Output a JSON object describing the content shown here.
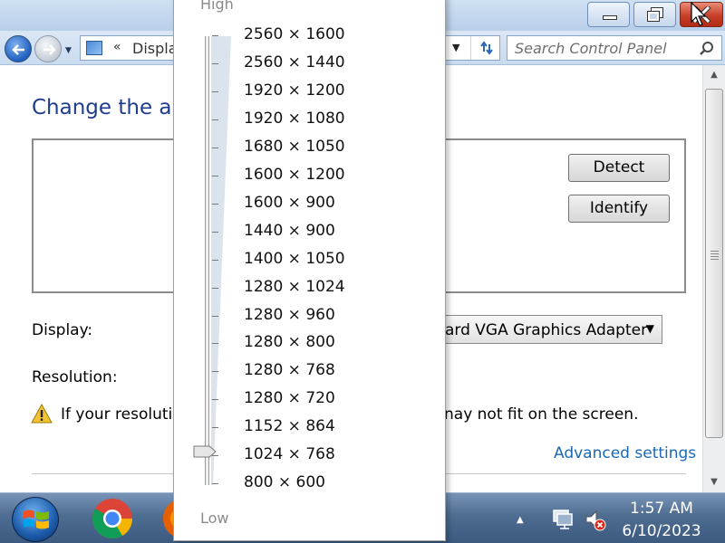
{
  "window": {
    "controls": [
      "minimize",
      "maximize",
      "close"
    ]
  },
  "nav": {
    "address_chevron": "«",
    "address_text": "Displa",
    "search_placeholder": "Search Control Panel"
  },
  "main": {
    "title": "Change the ap",
    "buttons": {
      "detect": "Detect",
      "identify": "Identify"
    },
    "display_label": "Display:",
    "display_value": "ard VGA Graphics Adapter",
    "resolution_label": "Resolution:",
    "warning_left": "If your resolutio",
    "warning_right": "nay not fit on the screen.",
    "advanced_link": "Advanced settings"
  },
  "resolution_popup": {
    "high_label": "High",
    "low_label": "Low",
    "options": [
      "2560 × 1600",
      "2560 × 1440",
      "1920 × 1200",
      "1920 × 1080",
      "1680 × 1050",
      "1600 × 1200",
      "1600 × 900",
      "1440 × 900",
      "1400 × 1050",
      "1280 × 1024",
      "1280 × 960",
      "1280 × 800",
      "1280 × 768",
      "1280 × 720",
      "1152 × 864",
      "1024 × 768",
      "800 × 600"
    ],
    "selected": "1024 × 768"
  },
  "taskbar": {
    "time": "1:57 AM",
    "date": "6/10/2023",
    "apps": [
      "start-orb",
      "chrome-icon",
      "firefox-icon"
    ]
  },
  "colors": {
    "title_blue": "#1e3d8f",
    "link_blue": "#1a68b8",
    "close_red": "#c7402a"
  }
}
